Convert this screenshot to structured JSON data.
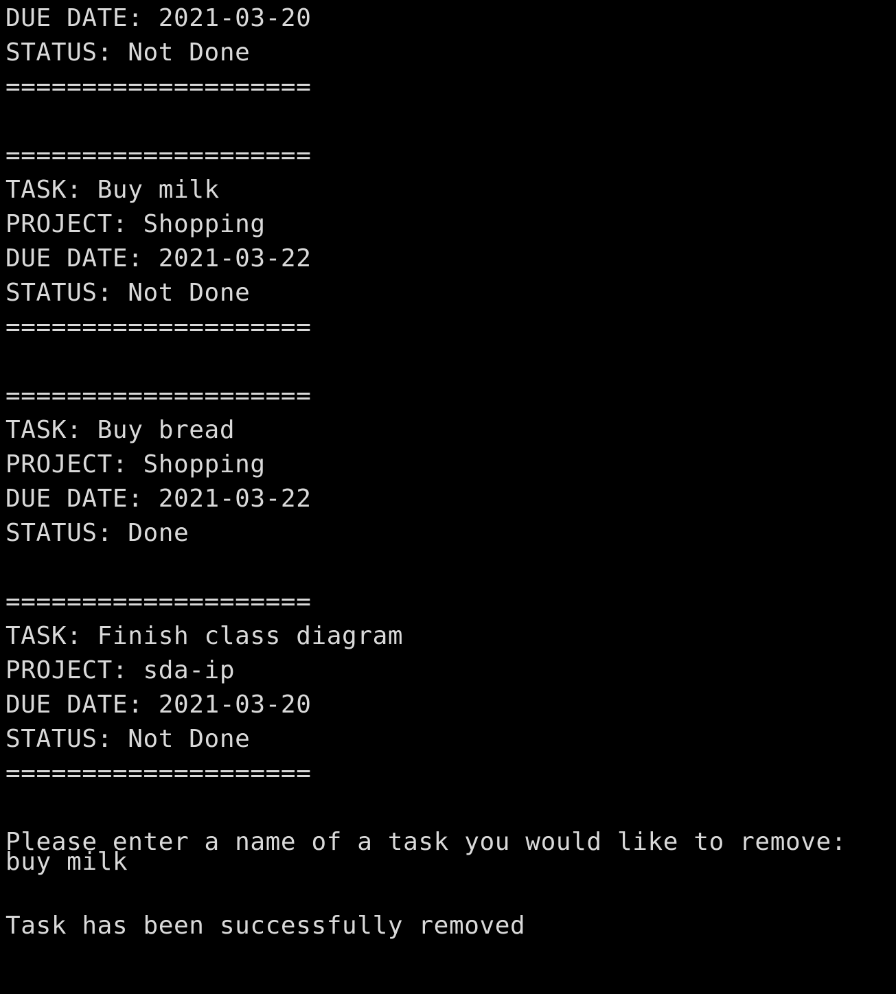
{
  "terminal": {
    "colors": {
      "background": "#000000",
      "text": "#d9d9d9"
    },
    "partial_task": {
      "due_date": "DUE DATE: 2021-03-20",
      "status": "STATUS: Not Done",
      "separator": "===================="
    },
    "tasks": [
      {
        "separator_top": "====================",
        "task": "TASK: Buy milk",
        "project": "PROJECT: Shopping",
        "due_date": "DUE DATE: 2021-03-22",
        "status": "STATUS: Not Done",
        "separator_bottom": "===================="
      },
      {
        "separator_top": "====================",
        "task": "TASK: Buy bread",
        "project": "PROJECT: Shopping",
        "due_date": "DUE DATE: 2021-03-22",
        "status": "STATUS: Done"
      },
      {
        "separator_top": "====================",
        "task": "TASK: Finish class diagram",
        "project": "PROJECT: sda-ip",
        "due_date": "DUE DATE: 2021-03-20",
        "status": "STATUS: Not Done",
        "separator_bottom": "===================="
      }
    ],
    "prompt": "Please enter a name of a task you would like to remove:",
    "user_input": "buy milk",
    "result_message": "Task has been successfully removed"
  }
}
